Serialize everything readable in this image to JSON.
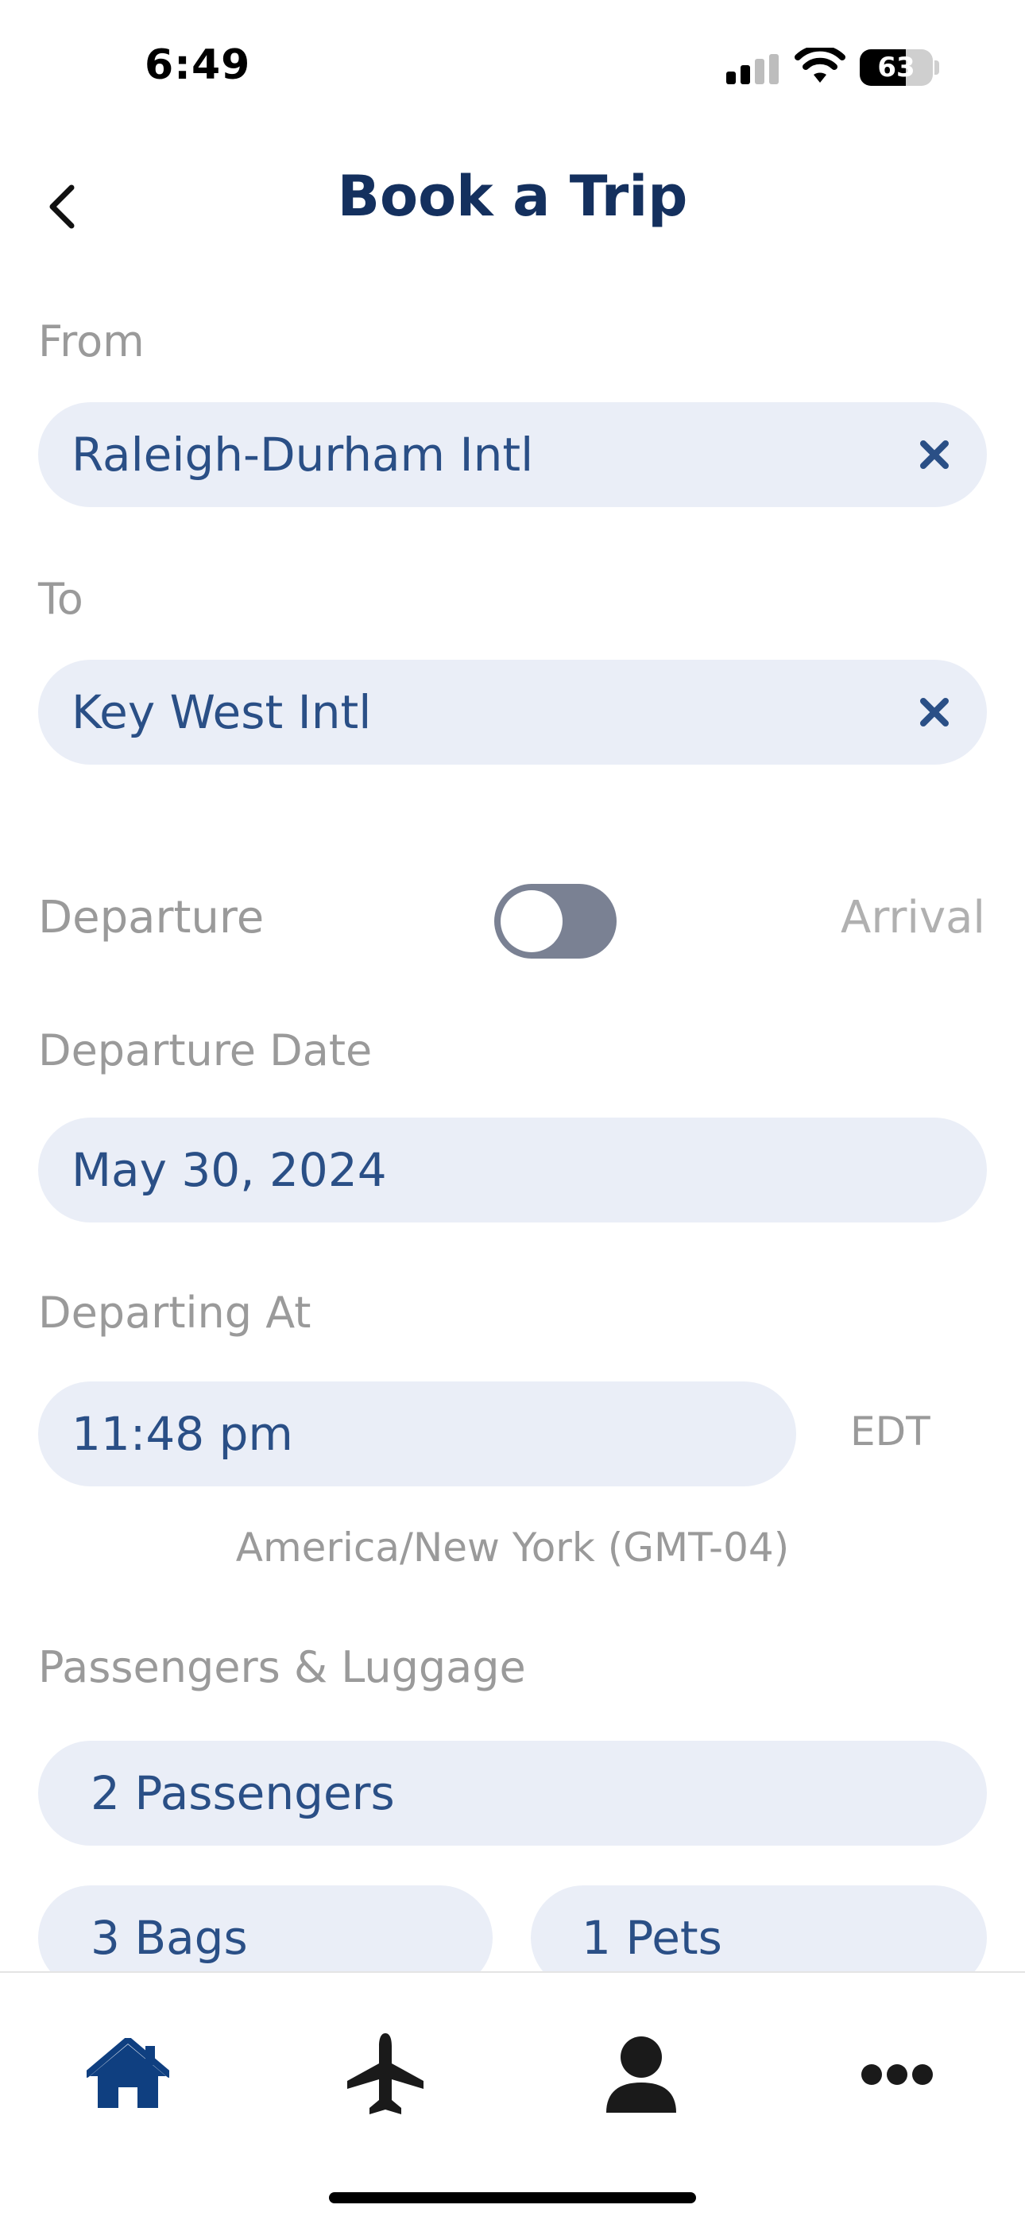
{
  "status_bar": {
    "time": "6:49",
    "battery": "63"
  },
  "header": {
    "title": "Book a Trip"
  },
  "from": {
    "label": "From",
    "value": "Raleigh-Durham Intl"
  },
  "to": {
    "label": "To",
    "value": "Key West Intl"
  },
  "mode_toggle": {
    "left_label": "Departure",
    "right_label": "Arrival",
    "selected": "Departure"
  },
  "date": {
    "label": "Departure Date",
    "value": "May 30, 2024"
  },
  "time_field": {
    "label": "Departing At",
    "value": "11:48 pm",
    "tz_abbr": "EDT",
    "tz_name": "America/New York (GMT-04)"
  },
  "passengers": {
    "label": "Passengers & Luggage",
    "passengers": "2 Passengers",
    "bags": "3 Bags",
    "pets": "1 Pets"
  },
  "tabbar": {
    "items": [
      "home-icon",
      "airplane-icon",
      "person-icon",
      "more-icon"
    ],
    "active": "home-icon"
  },
  "colors": {
    "accent": "#0f3f80",
    "field_bg": "#eaeef7",
    "field_text": "#2a4f86",
    "label": "#9a9a9a"
  }
}
